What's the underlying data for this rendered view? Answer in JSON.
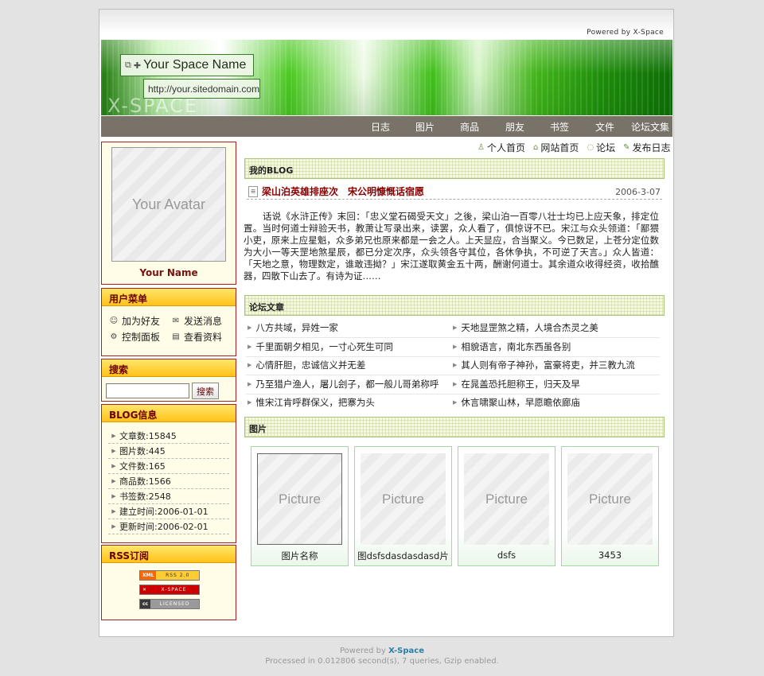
{
  "header": {
    "powered_text": "Powered by X-Space",
    "site_name": "Your Space Name",
    "site_url": "http://your.sitedomain.com",
    "banner_watermark": "X-SPACE"
  },
  "nav": [
    "日志",
    "图片",
    "商品",
    "朋友",
    "书签",
    "文件",
    "论坛文集"
  ],
  "sidebar": {
    "avatar_text": "Your Avatar",
    "user_name": "Your Name",
    "user_menu": {
      "title": "用户菜单",
      "items": [
        {
          "label": "加为好友",
          "icon": "add-friend-icon"
        },
        {
          "label": "发送消息",
          "icon": "message-icon"
        },
        {
          "label": "控制面板",
          "icon": "control-panel-icon"
        },
        {
          "label": "查看资料",
          "icon": "profile-icon"
        }
      ]
    },
    "search": {
      "title": "搜索",
      "button": "搜索",
      "value": ""
    },
    "blog_info": {
      "title": "BLOG信息",
      "items": [
        "文章数:15845",
        "图片数:445",
        "文件数:165",
        "商品数:1566",
        "书签数:2548",
        "建立时间:2006-01-01",
        "更新时间:2006-02-01"
      ]
    },
    "rss": {
      "title": "RSS订阅",
      "badges": [
        {
          "left": "XML",
          "right": "RSS 2.0",
          "left_color": "#ff6600",
          "right_color": "#ffcc33"
        },
        {
          "left": "✕",
          "right": "X-SPACE",
          "left_color": "#cc0000",
          "right_color": "#cc0000"
        },
        {
          "left": "cc",
          "right": "LICENSED",
          "left_color": "#3a3a3a",
          "right_color": "#9a9a9a"
        }
      ]
    }
  },
  "top_links": [
    "个人首页",
    "网站首页",
    "论坛",
    "发布日志"
  ],
  "blog": {
    "section_title": "我的BLOG",
    "post_title": "梁山泊英雄排座次　宋公明慷慨话宿愿",
    "post_date": "2006-3-07",
    "post_body": "话说《水浒正传》末回：「忠义堂石碣受天文」之後，梁山泊一百零八壮士均已上应天象，排定位置。当时何道士辩验天书，教萧让写录出来，读罢，众人看了，俱惊讶不已。宋江与众头领道：「鄙猥小吏，原来上应星魁，众多弟兄也原来都是一会之人。上天显应，合当聚义。今已数足，上苍分定位数为大小一等天罡地煞星辰，都已分定次序，众头领各守其位，各休争执，不可逆了天言。」众人皆道：「天地之意，物理数定，谁敢违拗？」宋江遂取黄金五十两，酬谢何道士。其余道众收得经资，收拾醮器，四散下山去了。有诗为证……"
  },
  "forum": {
    "section_title": "论坛文章",
    "articles": [
      "八方共域，异姓一家",
      "天地显罡煞之精，人境合杰灵之美",
      "千里面朝夕相见，一寸心死生可同",
      "相貌语言，南北东西虽各别",
      "心情肝胆，忠诚信义并无差",
      "其人则有帝子神孙，富豪将吏，并三教九流",
      "乃至猎户渔人，屠儿刽子，都一般儿哥弟称呼",
      "在晁盖恐托胆称王，归天及早",
      "惟宋江肯呼群保义，把寨为头",
      "休言啸聚山林，早愿瞻依廊庙"
    ]
  },
  "pictures": {
    "section_title": "图片",
    "placeholder": "Picture",
    "items": [
      "图片名称",
      "图dsfsdasdasdasd片",
      "dsfs",
      "3453"
    ]
  },
  "footer": {
    "powered_prefix": "Powered by ",
    "powered_brand": "X-Space",
    "processed": "Processed in 0.012806 second(s), 7 queries, Gzip enabled."
  }
}
